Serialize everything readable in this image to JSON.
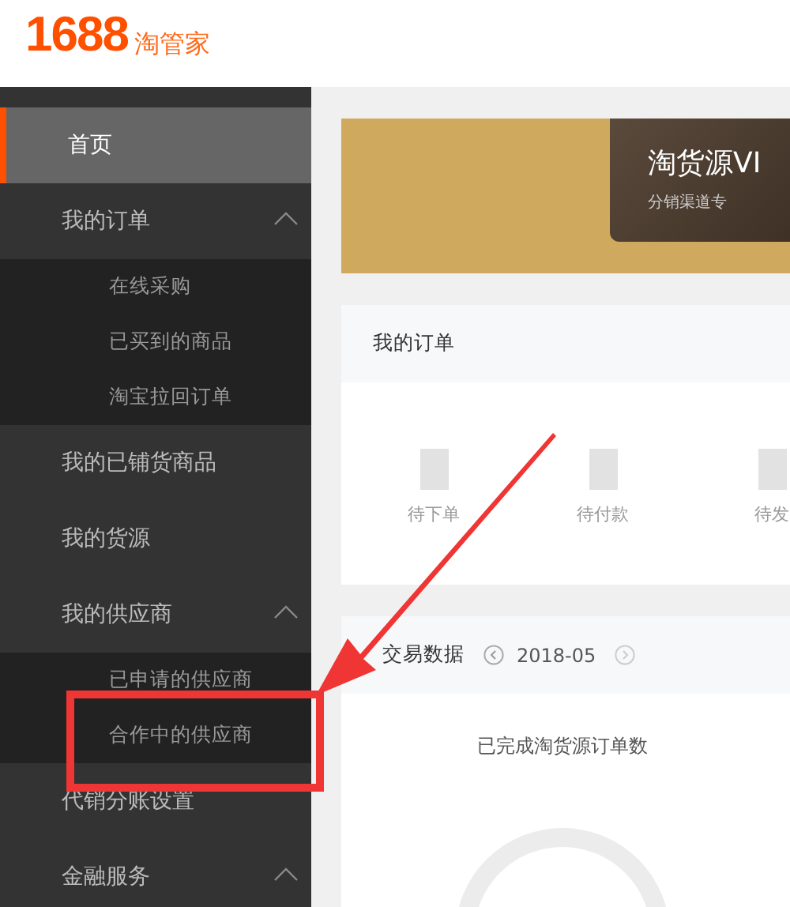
{
  "header": {
    "logo_number": "1688",
    "logo_text": "淘管家"
  },
  "sidebar": {
    "items": [
      {
        "label": "首页",
        "selected": true
      },
      {
        "label": "我的订单",
        "selected": false,
        "expanded": true,
        "children": [
          {
            "label": "在线采购",
            "selected": false
          },
          {
            "label": "已买到的商品",
            "selected": false
          },
          {
            "label": "淘宝拉回订单",
            "selected": false
          }
        ]
      },
      {
        "label": "我的已铺货商品",
        "selected": false
      },
      {
        "label": "我的货源",
        "selected": false
      },
      {
        "label": "我的供应商",
        "selected": false,
        "expanded": true,
        "children": [
          {
            "label": "已申请的供应商",
            "selected": false
          },
          {
            "label": "合作中的供应商",
            "selected": false
          }
        ]
      },
      {
        "label": "代销分账设置",
        "selected": false
      },
      {
        "label": "金融服务",
        "selected": false,
        "expanded": true
      }
    ]
  },
  "banner": {
    "title": "淘货源VI",
    "subtitle": "分销渠道专"
  },
  "orders": {
    "title": "我的订单",
    "items": [
      {
        "label": "待下单"
      },
      {
        "label": "待付款"
      },
      {
        "label": "待发"
      }
    ]
  },
  "trade": {
    "title": "交易数据",
    "month": "2018-05",
    "metric": "已完成淘货源订单数"
  }
}
